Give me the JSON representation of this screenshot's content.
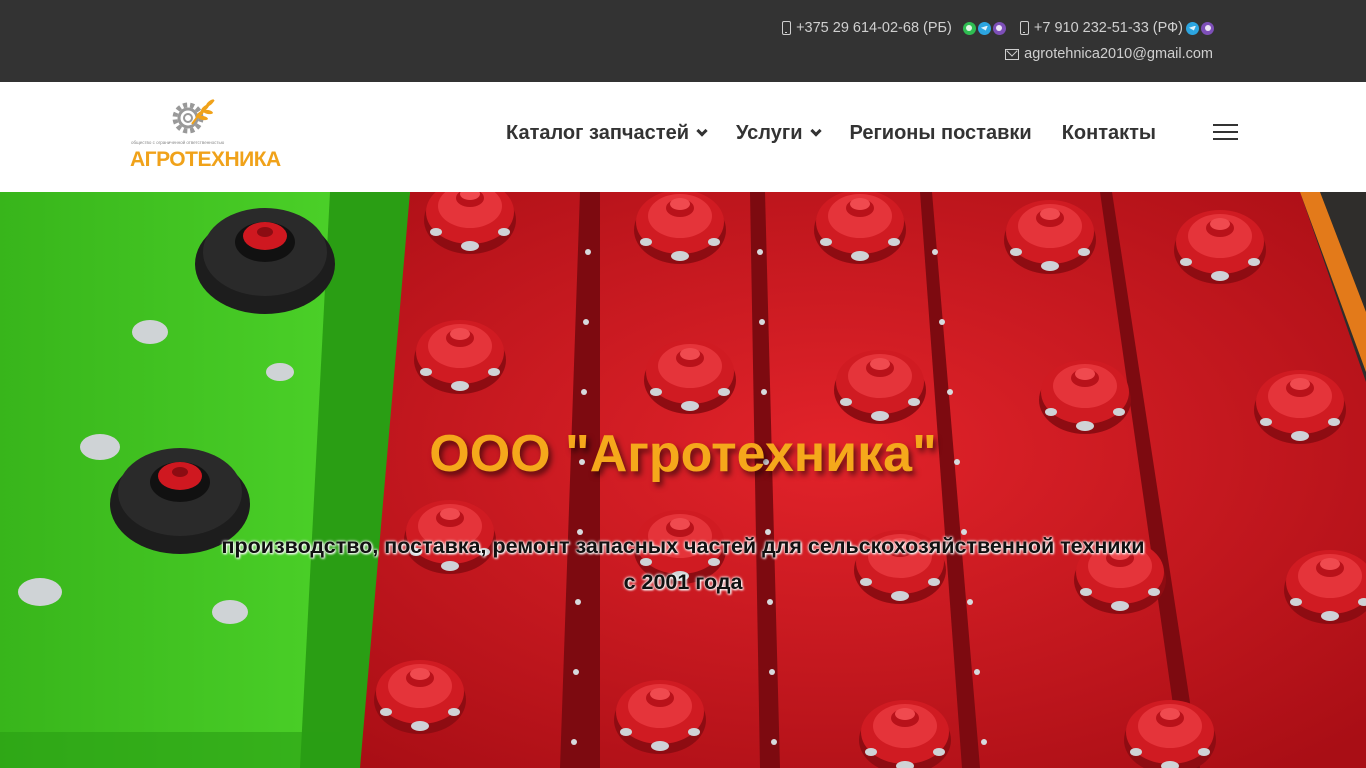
{
  "topbar": {
    "phone_rb": "+375 29 614-02-68 (РБ)",
    "phone_rf": "+7 910 232-51-33 (РФ)",
    "email": "agrotehnica2010@gmail.com",
    "icons": [
      "mobile-phone-icon",
      "whatsapp-icon",
      "telegram-icon",
      "viber-icon",
      "envelope-icon"
    ]
  },
  "header": {
    "logo_text": "АГРОТЕХНИКА",
    "logo_small_text": "общество с ограниченной ответственностью",
    "nav": {
      "catalog": "Каталог запчастей",
      "services": "Услуги",
      "regions": "Регионы поставки",
      "contacts": "Контакты"
    }
  },
  "hero": {
    "title": "ООО \"Агротехника\"",
    "subtitle": "производство, поставка, ремонт запасных частей для сельскохозяйственной техники с 2001 года"
  },
  "colors": {
    "topbar_bg": "#333333",
    "accent_orange": "#f5a81b",
    "hero_red": "#c8141c",
    "hero_green": "#3cc21e"
  }
}
